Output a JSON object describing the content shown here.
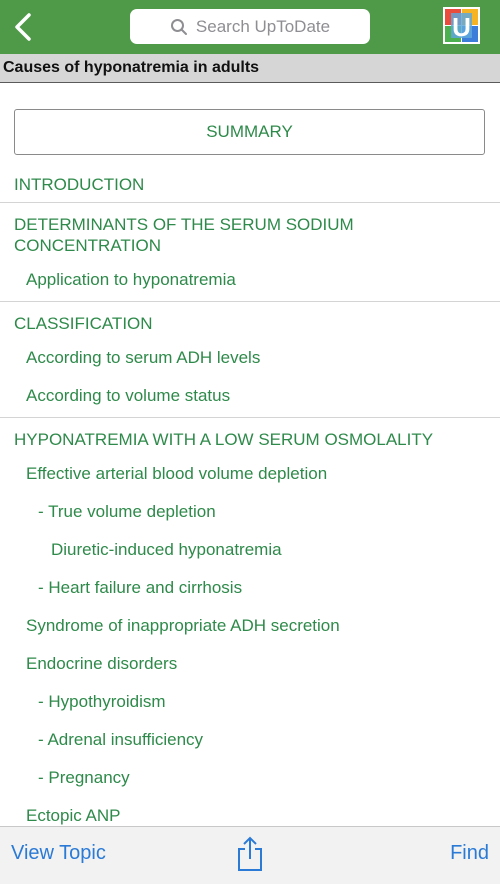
{
  "header": {
    "back_icon": "chevron-left-icon",
    "search_placeholder": "Search UpToDate",
    "search_icon": "search-icon",
    "logo_letter": "U",
    "bar_color": "#4f9a48"
  },
  "title": "Causes of hyponatremia in adults",
  "summary_label": "SUMMARY",
  "outline": [
    {
      "label": "INTRODUCTION",
      "level": 0
    },
    {
      "label": "DETERMINANTS OF THE SERUM SODIUM CONCENTRATION",
      "level": 0
    },
    {
      "label": "Application to hyponatremia",
      "level": 1
    },
    {
      "label": "CLASSIFICATION",
      "level": 0
    },
    {
      "label": "According to serum ADH levels",
      "level": 1
    },
    {
      "label": "According to volume status",
      "level": 1
    },
    {
      "label": "HYPONATREMIA WITH A LOW SERUM OSMOLALITY",
      "level": 0
    },
    {
      "label": "Effective arterial blood volume depletion",
      "level": 1
    },
    {
      "label": "- True volume depletion",
      "level": 2
    },
    {
      "label": "Diuretic-induced hyponatremia",
      "level": 3
    },
    {
      "label": "- Heart failure and cirrhosis",
      "level": 2
    },
    {
      "label": "Syndrome of inappropriate ADH secretion",
      "level": 1
    },
    {
      "label": "Endocrine disorders",
      "level": 1
    },
    {
      "label": "- Hypothyroidism",
      "level": 2
    },
    {
      "label": "- Adrenal insufficiency",
      "level": 2
    },
    {
      "label": "- Pregnancy",
      "level": 2
    },
    {
      "label": "Ectopic ANP",
      "level": 1
    }
  ],
  "footer": {
    "view_topic": "View Topic",
    "share_icon": "share-icon",
    "find": "Find"
  },
  "colors": {
    "link_green": "#2e8a4a",
    "link_blue": "#2a7ad6"
  }
}
